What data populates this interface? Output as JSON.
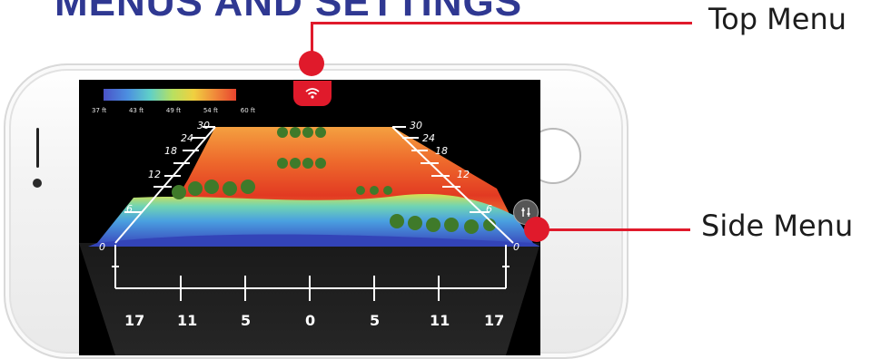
{
  "heading": "MENUS AND SETTINGS",
  "callouts": {
    "top_menu": "Top Menu",
    "side_menu": "Side Menu"
  },
  "legend": {
    "ticks": [
      "37 ft",
      "43 ft",
      "49 ft",
      "54 ft",
      "60 ft"
    ]
  },
  "bottom_axis": [
    "17",
    "11",
    "5",
    "0",
    "5",
    "11",
    "17"
  ],
  "left_axis": [
    "30",
    "24",
    "18",
    "12",
    "6",
    "0"
  ],
  "right_axis": [
    "30",
    "24",
    "18",
    "12",
    "6",
    "0"
  ],
  "icons": {
    "top_menu": "wifi-icon",
    "side_menu": "sliders-icon"
  },
  "colors": {
    "accent": "#e01a2b",
    "heading": "#2f3892"
  }
}
